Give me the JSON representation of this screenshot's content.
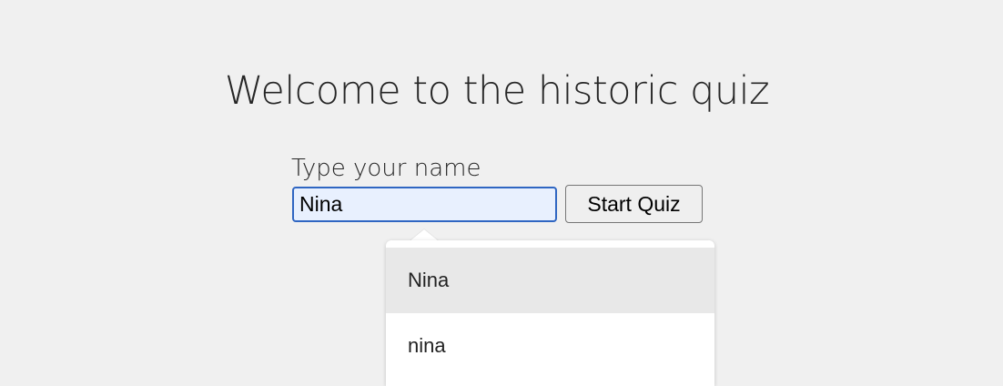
{
  "page": {
    "title": "Welcome to the historic quiz"
  },
  "form": {
    "name_label": "Type your name",
    "name_value": "Nina",
    "start_button_label": "Start Quiz"
  },
  "autocomplete": {
    "suggestions": [
      {
        "label": "Nina",
        "highlighted": true
      },
      {
        "label": "nina",
        "highlighted": false
      }
    ]
  },
  "colors": {
    "background": "#f0f0f0",
    "input_focus_border": "#2f66c2",
    "input_autofill_bg": "#e8f0fe",
    "suggestion_highlight": "#e8e8e8"
  }
}
